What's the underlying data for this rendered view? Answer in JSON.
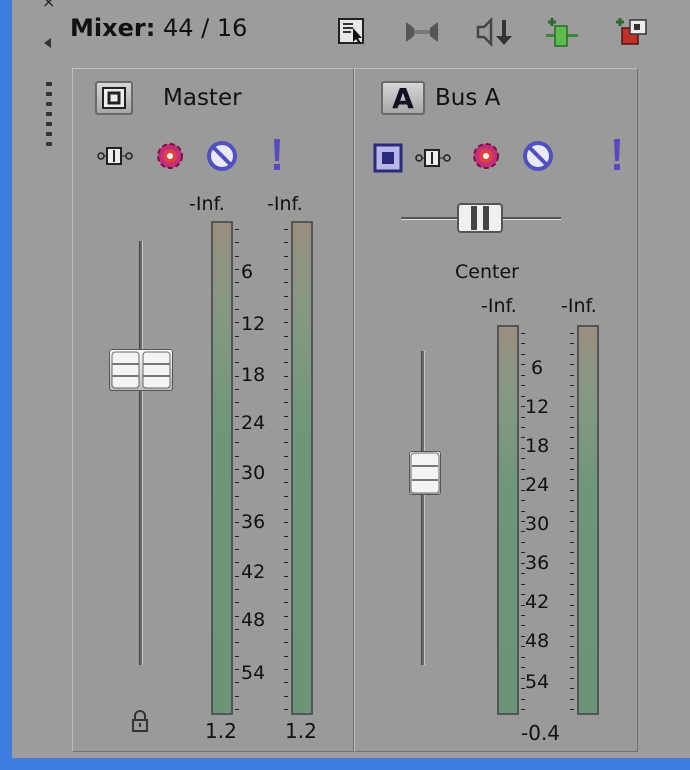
{
  "window": {
    "title_bold": "Mixer:",
    "title_count": "44 / 16",
    "close_glyph": "×"
  },
  "toolbar": {
    "icons": [
      "pointer-icon",
      "downmix-icon",
      "speaker-mute-icon",
      "insert-bus-icon",
      "insert-fx-icon"
    ]
  },
  "master": {
    "label": "Master",
    "button_glyph": "◘",
    "peak_left": "-Inf.",
    "peak_right": "-Inf.",
    "scale": [
      "6",
      "12",
      "18",
      "24",
      "30",
      "36",
      "42",
      "48",
      "54"
    ],
    "bottom_left": "1.2",
    "bottom_right": "1.2"
  },
  "bus_a": {
    "label": "Bus A",
    "button_letter": "A",
    "pan_label": "Center",
    "peak_left": "-Inf.",
    "peak_right": "-Inf.",
    "scale": [
      "6",
      "12",
      "18",
      "24",
      "30",
      "36",
      "42",
      "48",
      "54"
    ],
    "bottom_value": "-0.4"
  },
  "colors": {
    "frame": "#3d7de0",
    "panel": "#9c9c9c",
    "meter_top": "#9a8e80",
    "meter_green": "#6c9778"
  }
}
